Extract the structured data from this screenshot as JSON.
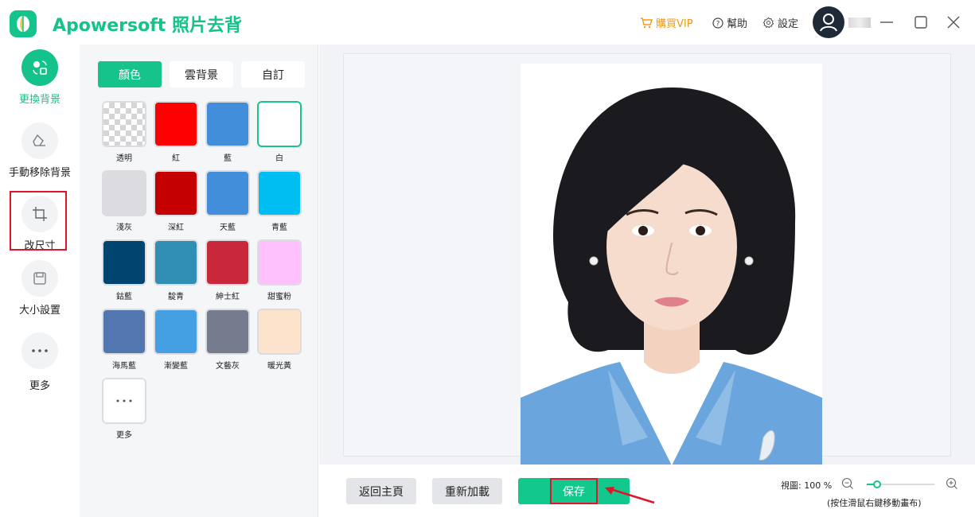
{
  "app": {
    "title": "Apowersoft 照片去背",
    "brand_color": "#12c489"
  },
  "header": {
    "vip_label": "購買VIP",
    "help_label": "幫助",
    "settings_label": "設定"
  },
  "nav": {
    "items": [
      {
        "label": "更換背景",
        "icon": "swap-icon",
        "active": true
      },
      {
        "label": "手動移除背景",
        "icon": "eraser-icon",
        "active": false
      },
      {
        "label": "改尺寸",
        "icon": "crop-icon",
        "active": false
      },
      {
        "label": "大小設置",
        "icon": "save-size-icon",
        "active": false
      },
      {
        "label": "更多",
        "icon": "more-icon",
        "active": false
      }
    ]
  },
  "panel": {
    "tabs": [
      "顏色",
      "雲背景",
      "自訂"
    ],
    "active_tab": "顏色",
    "colors": [
      {
        "label": "透明",
        "color": "transparent"
      },
      {
        "label": "紅",
        "color": "#ff0000"
      },
      {
        "label": "藍",
        "color": "#438edb"
      },
      {
        "label": "白",
        "color": "#ffffff"
      },
      {
        "label": "淺灰",
        "color": "#dcdce0"
      },
      {
        "label": "深紅",
        "color": "#c40000"
      },
      {
        "label": "天藍",
        "color": "#438edb"
      },
      {
        "label": "青藍",
        "color": "#00bef2"
      },
      {
        "label": "鈷藍",
        "color": "#00456f"
      },
      {
        "label": "靛青",
        "color": "#318fb5"
      },
      {
        "label": "紳士紅",
        "color": "#c9283a"
      },
      {
        "label": "甜蜜粉",
        "color": "#fec1fe"
      },
      {
        "label": "海馬藍",
        "color": "#5277b0"
      },
      {
        "label": "漸變藍",
        "color": "#45a0e3"
      },
      {
        "label": "文藝灰",
        "color": "#767c8e"
      },
      {
        "label": "暖光黃",
        "color": "#fde2cc"
      }
    ],
    "more_label": "更多",
    "selected_color": "白"
  },
  "bottom": {
    "home_label": "返回主頁",
    "reload_label": "重新加載",
    "save_label": "保存",
    "zoom_label": "視圖: 100 %",
    "zoom_hint": "(按住滑鼠右鍵移動畫布)",
    "zoom_level": 0.15
  }
}
